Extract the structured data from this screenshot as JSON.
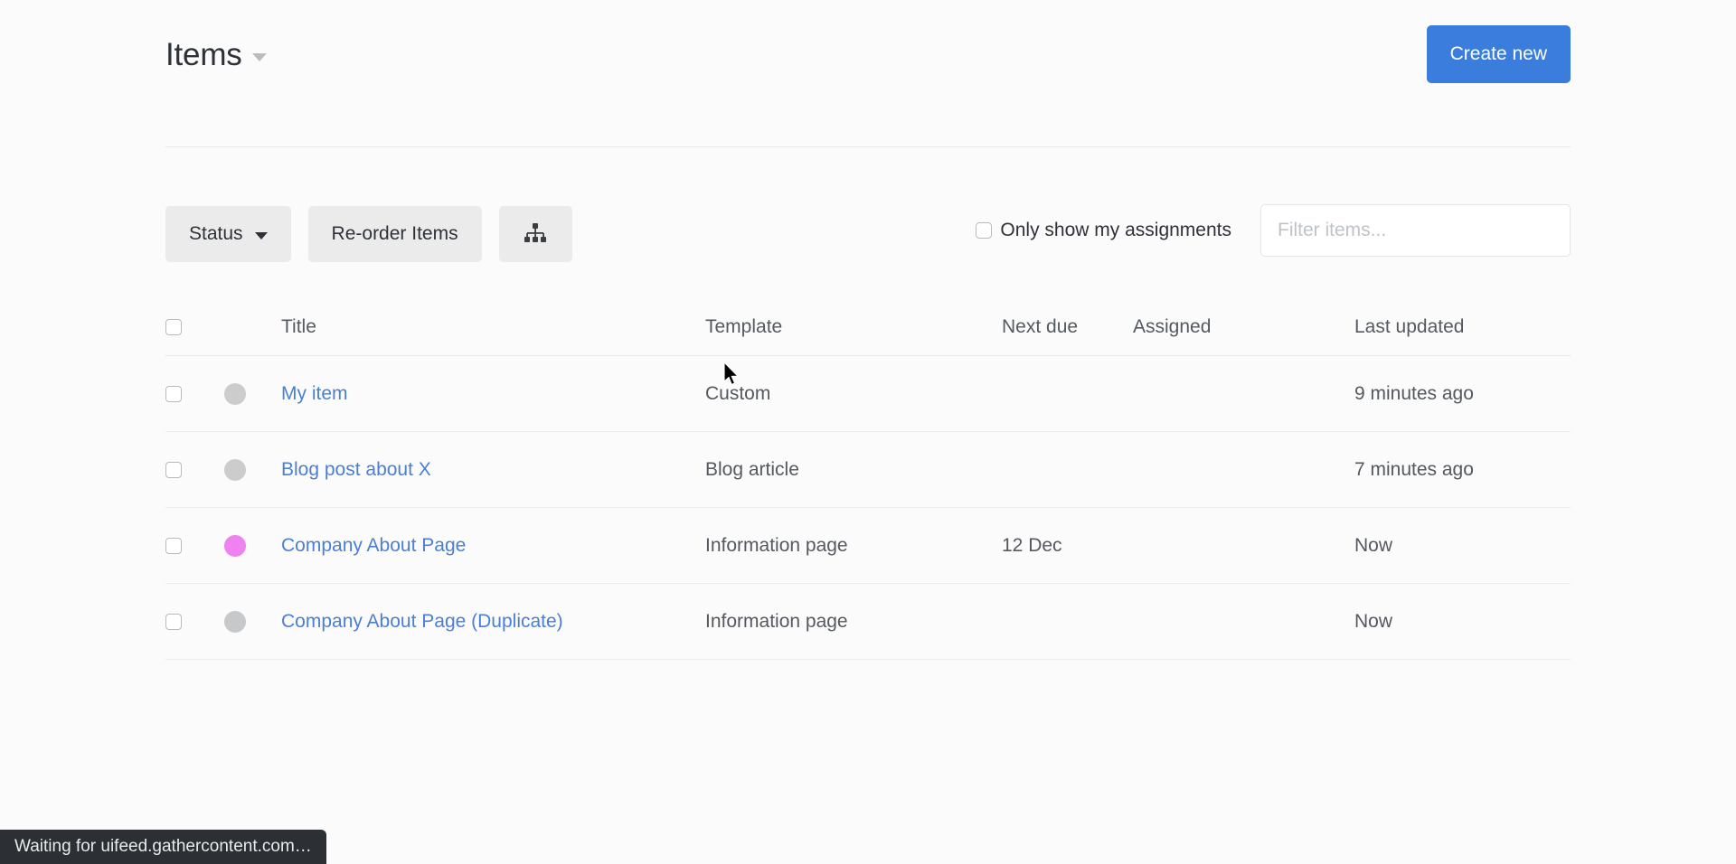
{
  "header": {
    "title": "Items",
    "title_caret_icon": "chevron-down-icon",
    "create_label": "Create new",
    "accent_color": "#3b7ddd"
  },
  "toolbar": {
    "status_label": "Status",
    "status_caret_icon": "chevron-down-icon",
    "reorder_label": "Re-order Items",
    "sitemap_icon": "sitemap-icon",
    "assignments_label": "Only show my assignments",
    "assignments_checked": false,
    "filter_placeholder": "Filter items...",
    "filter_value": ""
  },
  "table": {
    "columns": [
      {
        "key": "select",
        "label": ""
      },
      {
        "key": "status",
        "label": ""
      },
      {
        "key": "title",
        "label": "Title"
      },
      {
        "key": "template",
        "label": "Template"
      },
      {
        "key": "next_due",
        "label": "Next due"
      },
      {
        "key": "assigned",
        "label": "Assigned"
      },
      {
        "key": "last_updated",
        "label": "Last updated"
      }
    ],
    "rows": [
      {
        "selected": false,
        "status_color": "#cccccc",
        "title": "My item",
        "template": "Custom",
        "next_due": "",
        "assigned": "",
        "last_updated": "9 minutes ago"
      },
      {
        "selected": false,
        "status_color": "#cccccc",
        "title": "Blog post about X",
        "template": "Blog article",
        "next_due": "",
        "assigned": "",
        "last_updated": "7 minutes ago"
      },
      {
        "selected": false,
        "status_color": "#ee82ee",
        "title": "Company About Page",
        "template": "Information page",
        "next_due": "12 Dec",
        "assigned": "",
        "last_updated": "Now"
      },
      {
        "selected": false,
        "status_color": "#c6c8ca",
        "title": "Company About Page (Duplicate)",
        "template": "Information page",
        "next_due": "",
        "assigned": "",
        "last_updated": "Now"
      }
    ]
  },
  "statusbar": {
    "text": "Waiting for uifeed.gathercontent.com…"
  }
}
